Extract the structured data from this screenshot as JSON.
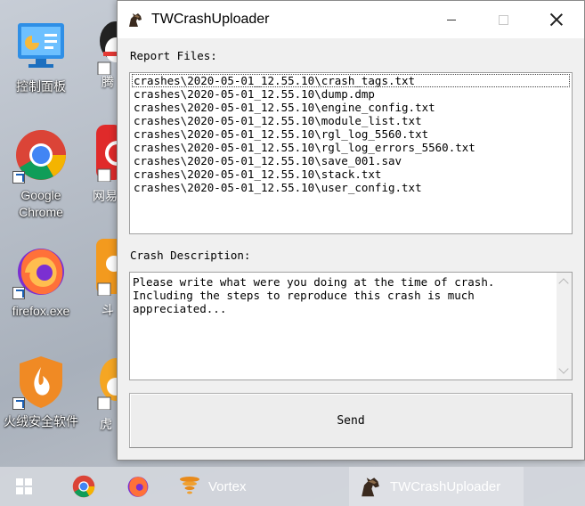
{
  "desktop": {
    "icons": [
      {
        "label": "控制面板"
      },
      {
        "label": "Google\nChrome"
      },
      {
        "label": "firefox.exe"
      },
      {
        "label": "火绒安全软件"
      }
    ],
    "partial_labels": [
      "腾",
      "网易",
      "斗",
      "虎"
    ]
  },
  "window": {
    "title": "TWCrashUploader",
    "report_files_label": "Report Files:",
    "report_files": [
      "crashes\\2020-05-01_12.55.10\\crash_tags.txt",
      "crashes\\2020-05-01_12.55.10\\dump.dmp",
      "crashes\\2020-05-01_12.55.10\\engine_config.txt",
      "crashes\\2020-05-01_12.55.10\\module_list.txt",
      "crashes\\2020-05-01_12.55.10\\rgl_log_5560.txt",
      "crashes\\2020-05-01_12.55.10\\rgl_log_errors_5560.txt",
      "crashes\\2020-05-01_12.55.10\\save_001.sav",
      "crashes\\2020-05-01_12.55.10\\stack.txt",
      "crashes\\2020-05-01_12.55.10\\user_config.txt"
    ],
    "crash_description_label": "Crash Description:",
    "crash_description_text": "Please write what were you doing at the time of crash.\nIncluding the steps to reproduce this crash is much\nappreciated...",
    "send_label": "Send"
  },
  "taskbar": {
    "items": [
      {
        "label": "Vortex"
      },
      {
        "label": "TWCrashUploader"
      }
    ]
  },
  "colors": {
    "window_bg": "#f0f0f0",
    "titlebar_bg": "#ffffff",
    "taskbar_bg": "#d2d6dc"
  }
}
